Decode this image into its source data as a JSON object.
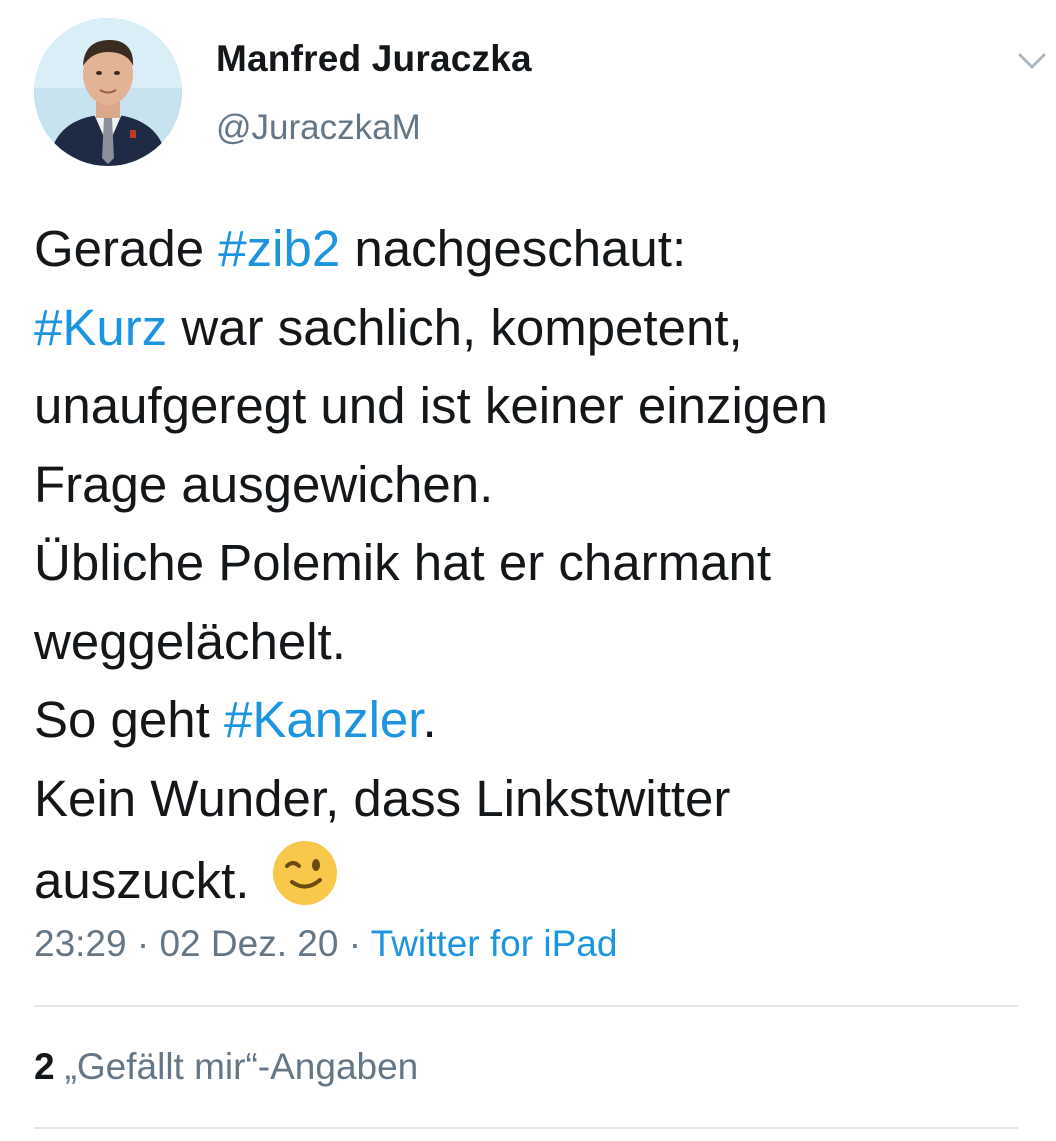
{
  "author": {
    "name": "Manfred Juraczka",
    "handle": "@JuraczkaM"
  },
  "tweet": {
    "lines": [
      [
        {
          "t": "Gerade "
        },
        {
          "t": "#zib2",
          "tag": true
        },
        {
          "t": " nachgeschaut:"
        }
      ],
      [
        {
          "t": "#Kurz",
          "tag": true
        },
        {
          "t": " war sachlich, kompetent,"
        }
      ],
      [
        {
          "t": "unaufgeregt und ist keiner einzigen"
        }
      ],
      [
        {
          "t": "Frage ausgewichen."
        }
      ],
      [
        {
          "t": "Übliche Polemik hat er charmant"
        }
      ],
      [
        {
          "t": "weggelächelt."
        }
      ],
      [
        {
          "t": "So geht "
        },
        {
          "t": "#Kanzler",
          "tag": true
        },
        {
          "t": "."
        }
      ],
      [
        {
          "t": "Kein Wunder, dass Linkstwitter"
        }
      ],
      [
        {
          "t": "auszuckt. "
        },
        {
          "emoji": "winking-face-emoji"
        }
      ]
    ]
  },
  "meta": {
    "time": "23:29",
    "sep1": " · ",
    "date": "02 Dez. 20",
    "sep2": " · ",
    "source": "Twitter for iPad"
  },
  "stats": {
    "likes_count": "2",
    "likes_label": "„Gefällt mir“-Angaben"
  },
  "icons": {
    "more": "chevron-down-icon",
    "emoji": "winking-face-emoji"
  },
  "colors": {
    "text": "#14171a",
    "secondary": "#657786",
    "link": "#1b95e0",
    "divider": "#e1e8ed"
  }
}
